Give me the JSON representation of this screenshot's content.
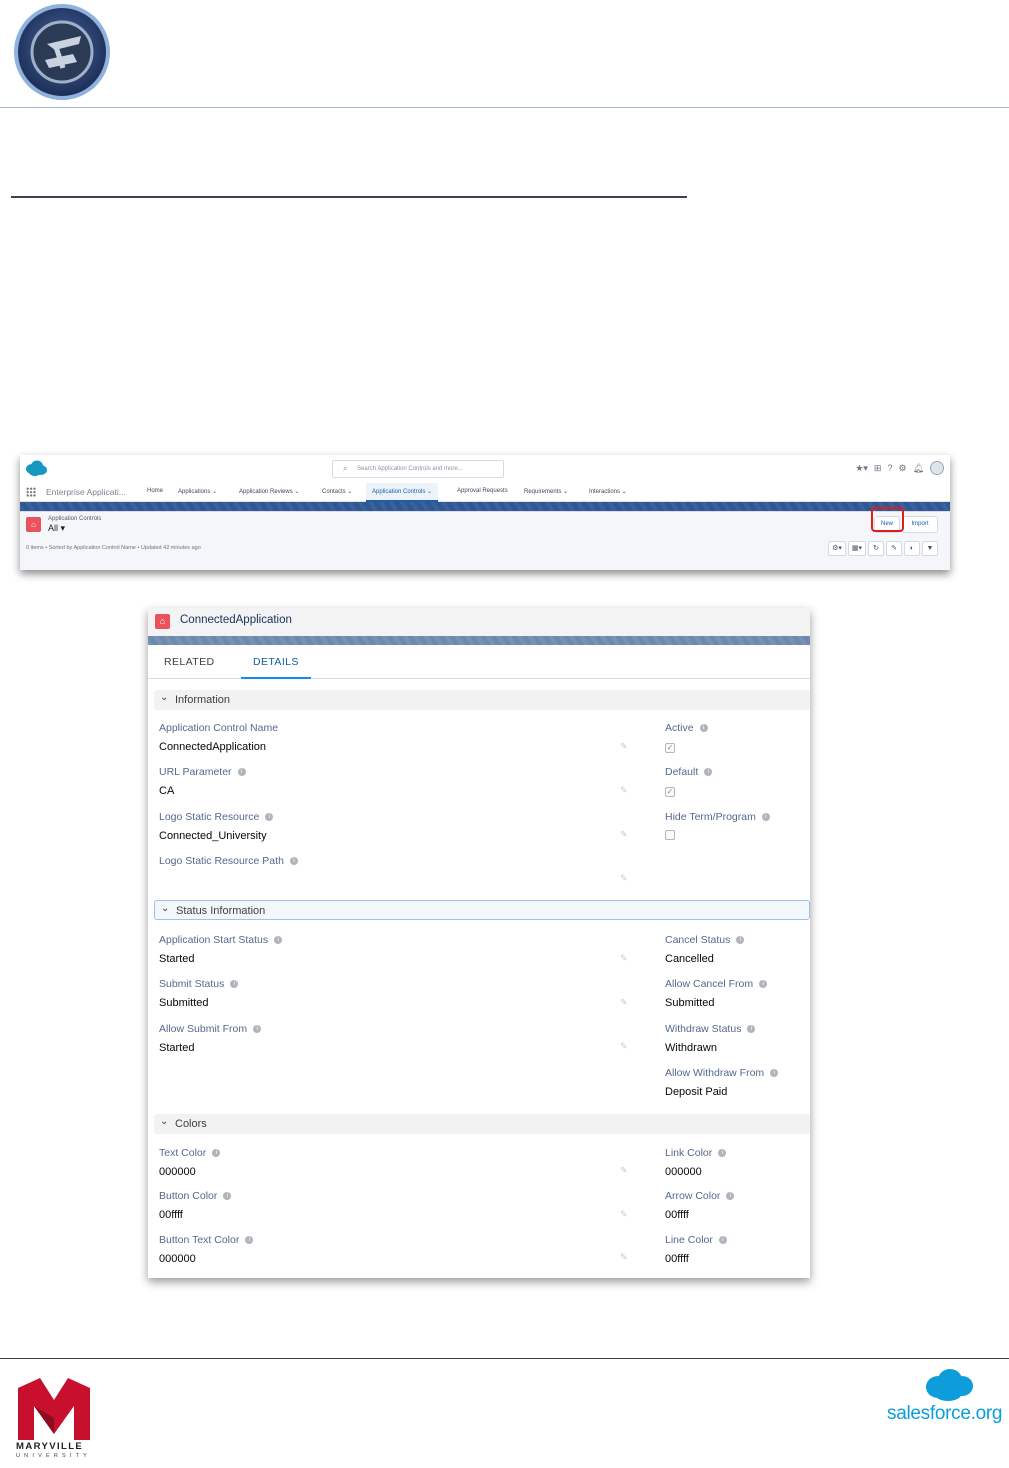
{
  "listview": {
    "search_placeholder": "Search Application Controls and more...",
    "app_name": "Enterprise Applicati...",
    "nav": [
      {
        "label": "Home"
      },
      {
        "label": "Applications ⌄"
      },
      {
        "label": "Application Reviews ⌄"
      },
      {
        "label": "Contacts ⌄"
      },
      {
        "label": "Application Controls ⌄"
      },
      {
        "label": "Approval Requests"
      },
      {
        "label": "Requirements ⌄"
      },
      {
        "label": "Interactions ⌄"
      }
    ],
    "object_label": "Application Controls",
    "list_name": "All ▾",
    "meta": "0 items • Sorted by Application Control Name • Updated 42 minutes ago",
    "new_label": "New",
    "import_label": "Import",
    "tools": [
      "⚙▾",
      "▦▾",
      "↻",
      "✎",
      "◐",
      "▼"
    ]
  },
  "record": {
    "title": "ConnectedApplication",
    "tabs": [
      "RELATED",
      "DETAILS"
    ],
    "sections": {
      "information": "Information",
      "status": "Status Information",
      "colors": "Colors"
    },
    "information": {
      "app_control_name": {
        "label": "Application Control Name",
        "value": "ConnectedApplication"
      },
      "url_parameter": {
        "label": "URL Parameter",
        "value": "CA"
      },
      "logo_static_resource": {
        "label": "Logo Static Resource",
        "value": "Connected_University"
      },
      "logo_static_resource_path": {
        "label": "Logo Static Resource Path",
        "value": ""
      },
      "active": {
        "label": "Active",
        "checked": true
      },
      "default": {
        "label": "Default",
        "checked": true
      },
      "hide_term_program": {
        "label": "Hide Term/Program",
        "checked": false
      }
    },
    "status": {
      "application_start_status": {
        "label": "Application Start Status",
        "value": "Started"
      },
      "submit_status": {
        "label": "Submit Status",
        "value": "Submitted"
      },
      "allow_submit_from": {
        "label": "Allow Submit From",
        "value": "Started"
      },
      "cancel_status": {
        "label": "Cancel Status",
        "value": "Cancelled"
      },
      "allow_cancel_from": {
        "label": "Allow Cancel From",
        "value": "Submitted"
      },
      "withdraw_status": {
        "label": "Withdraw Status",
        "value": "Withdrawn"
      },
      "allow_withdraw_from": {
        "label": "Allow Withdraw From",
        "value": "Deposit Paid"
      }
    },
    "colors": {
      "text_color": {
        "label": "Text Color",
        "value": "000000"
      },
      "button_color": {
        "label": "Button Color",
        "value": "00ffff"
      },
      "button_text_color": {
        "label": "Button Text Color",
        "value": "000000"
      },
      "link_color": {
        "label": "Link Color",
        "value": "000000"
      },
      "arrow_color": {
        "label": "Arrow Color",
        "value": "00ffff"
      },
      "line_color": {
        "label": "Line Color",
        "value": "00ffff"
      }
    }
  },
  "footer": {
    "maryville_name": "MARYVILLE",
    "maryville_sub": "UNIVERSITY",
    "salesforce_org": "salesforce.org"
  },
  "colors": {
    "salesforce_blue": "#0d9dda",
    "maryville_red": "#c8102e",
    "highlight_red": "#e01d1d"
  }
}
